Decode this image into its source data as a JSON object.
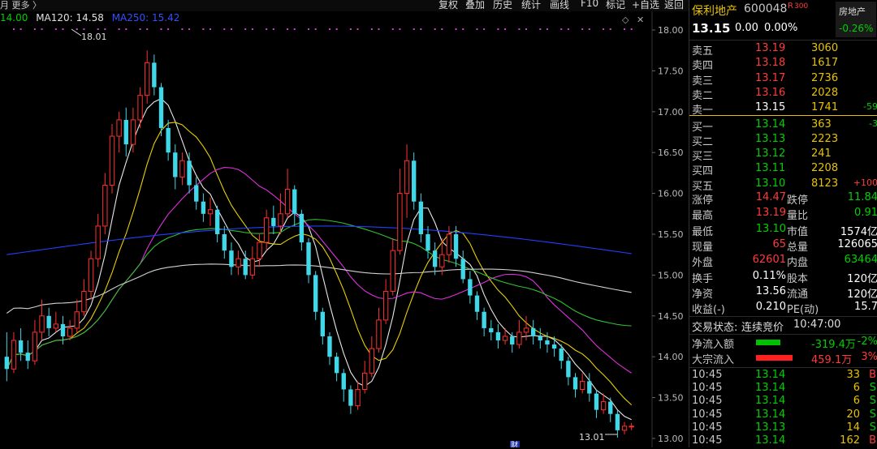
{
  "toolbar": {
    "left_text": "月 更多 〉",
    "buttons": [
      "复权",
      "叠加",
      "历史",
      "统计",
      "画线",
      "F10",
      "标记",
      "+自选",
      "返回"
    ]
  },
  "legend": [
    {
      "label": "14.00",
      "color": "#00d000"
    },
    {
      "label": "MA120: 14.58",
      "color": "#e0e0e0"
    },
    {
      "label": "MA250: 15.42",
      "color": "#3050ff"
    }
  ],
  "annotations": {
    "high": "18.01",
    "low": "13.01",
    "marker": "财"
  },
  "stock": {
    "name": "保利地产",
    "code": "600048",
    "badge": "R",
    "badge_num": "300",
    "sector": "房地产",
    "sector_change": "-0.26%",
    "price": "13.15",
    "change": "0.00",
    "change_pct": "0.00%"
  },
  "order_book": {
    "sell": [
      {
        "label": "卖五",
        "price": "13.19",
        "vol": "3060",
        "delta": ""
      },
      {
        "label": "卖四",
        "price": "13.18",
        "vol": "1617",
        "delta": ""
      },
      {
        "label": "卖三",
        "price": "13.17",
        "vol": "2736",
        "delta": ""
      },
      {
        "label": "卖二",
        "price": "13.16",
        "vol": "2028",
        "delta": ""
      },
      {
        "label": "卖一",
        "price": "13.15",
        "vol": "1741",
        "delta": "-59"
      }
    ],
    "buy": [
      {
        "label": "买一",
        "price": "13.14",
        "vol": "363",
        "delta": "-3"
      },
      {
        "label": "买二",
        "price": "13.13",
        "vol": "2223",
        "delta": ""
      },
      {
        "label": "买三",
        "price": "13.12",
        "vol": "241",
        "delta": ""
      },
      {
        "label": "买四",
        "price": "13.11",
        "vol": "2208",
        "delta": ""
      },
      {
        "label": "买五",
        "price": "13.10",
        "vol": "8123",
        "delta": "+100"
      }
    ]
  },
  "stats": [
    {
      "l1": "涨停",
      "v1": "14.47",
      "c1": "red",
      "l2": "跌停",
      "v2": "11.84",
      "c2": "green"
    },
    {
      "l1": "最高",
      "v1": "13.19",
      "c1": "red",
      "l2": "量比",
      "v2": "0.91",
      "c2": "green"
    },
    {
      "l1": "最低",
      "v1": "13.10",
      "c1": "green",
      "l2": "市值",
      "v2": "1574亿",
      "c2": "white"
    },
    {
      "l1": "现量",
      "v1": "65",
      "c1": "red",
      "l2": "总量",
      "v2": "126065",
      "c2": "white"
    },
    {
      "l1": "外盘",
      "v1": "62601",
      "c1": "red",
      "l2": "内盘",
      "v2": "63464",
      "c2": "green"
    },
    {
      "l1": "换手",
      "v1": "0.11%",
      "c1": "white",
      "l2": "股本",
      "v2": "120亿",
      "c2": "white"
    },
    {
      "l1": "净资",
      "v1": "13.56",
      "c1": "white",
      "l2": "流通",
      "v2": "120亿",
      "c2": "white"
    },
    {
      "l1": "收益(-)",
      "v1": "0.210",
      "c1": "white",
      "l2": "PE(动)",
      "v2": "15.7",
      "c2": "white"
    }
  ],
  "trade_status": {
    "label": "交易状态:",
    "state": "连续竞价",
    "time": "10:47:00"
  },
  "flows": [
    {
      "label": "净流入额",
      "value": "-319.4万",
      "pct": "-2%",
      "bar_color": "#00c000",
      "color": "green"
    },
    {
      "label": "大宗流入",
      "value": "459.1万",
      "pct": "3%",
      "bar_color": "#ff2020",
      "color": "red"
    }
  ],
  "ticks": [
    {
      "time": "10:45",
      "price": "13.14",
      "vol": "33",
      "side": "B",
      "side_color": "red"
    },
    {
      "time": "10:45",
      "price": "13.14",
      "vol": "6",
      "side": "S",
      "side_color": "green"
    },
    {
      "time": "10:45",
      "price": "13.14",
      "vol": "6",
      "side": "S",
      "side_color": "green"
    },
    {
      "time": "10:45",
      "price": "13.14",
      "vol": "20",
      "side": "S",
      "side_color": "green"
    },
    {
      "time": "10:45",
      "price": "13.13",
      "vol": "14",
      "side": "S",
      "side_color": "green"
    },
    {
      "time": "10:45",
      "price": "13.14",
      "vol": "162",
      "side": "B",
      "side_color": "red"
    }
  ],
  "chart_data": {
    "type": "candlestick",
    "ylim": [
      12.95,
      18.05
    ],
    "y_ticks": [
      "18.00",
      "17.50",
      "17.00",
      "16.50",
      "16.00",
      "15.50",
      "15.00",
      "14.50",
      "14.00",
      "13.50",
      "13.00"
    ],
    "candles": [
      [
        14.0,
        13.85,
        14.3,
        13.7
      ],
      [
        13.85,
        14.2,
        14.3,
        13.8
      ],
      [
        14.2,
        14.05,
        14.35,
        13.95
      ],
      [
        14.05,
        13.95,
        14.2,
        13.85
      ],
      [
        13.95,
        14.3,
        14.45,
        13.9
      ],
      [
        14.3,
        14.5,
        14.7,
        14.2
      ],
      [
        14.5,
        14.35,
        14.6,
        14.25
      ],
      [
        14.35,
        14.4,
        14.55,
        14.3
      ],
      [
        14.4,
        14.25,
        14.5,
        14.15
      ],
      [
        14.25,
        14.35,
        14.45,
        14.2
      ],
      [
        14.35,
        14.55,
        14.7,
        14.3
      ],
      [
        14.55,
        14.8,
        14.95,
        14.5
      ],
      [
        14.8,
        15.2,
        15.3,
        14.7
      ],
      [
        15.2,
        15.6,
        15.75,
        15.1
      ],
      [
        15.6,
        16.1,
        16.25,
        15.5
      ],
      [
        16.1,
        16.7,
        16.85,
        16.0
      ],
      [
        16.7,
        16.9,
        17.0,
        16.5
      ],
      [
        16.9,
        16.6,
        17.05,
        16.45
      ],
      [
        16.6,
        16.9,
        17.05,
        16.5
      ],
      [
        16.9,
        17.2,
        17.3,
        16.8
      ],
      [
        17.2,
        17.6,
        17.75,
        17.1
      ],
      [
        17.6,
        17.3,
        17.7,
        17.2
      ],
      [
        17.3,
        16.8,
        17.35,
        16.7
      ],
      [
        16.8,
        16.5,
        16.9,
        16.4
      ],
      [
        16.5,
        16.2,
        16.6,
        16.05
      ],
      [
        16.2,
        16.4,
        16.5,
        16.1
      ],
      [
        16.4,
        16.1,
        16.5,
        16.0
      ],
      [
        16.1,
        15.9,
        16.2,
        15.8
      ],
      [
        15.9,
        15.75,
        16.0,
        15.65
      ],
      [
        15.75,
        15.8,
        15.95,
        15.6
      ],
      [
        15.8,
        15.5,
        15.85,
        15.4
      ],
      [
        15.5,
        15.3,
        15.6,
        15.2
      ],
      [
        15.3,
        15.1,
        15.4,
        15.0
      ],
      [
        15.1,
        15.2,
        15.3,
        15.0
      ],
      [
        15.2,
        15.0,
        15.3,
        14.95
      ],
      [
        15.0,
        15.2,
        15.35,
        14.95
      ],
      [
        15.2,
        15.4,
        15.5,
        15.1
      ],
      [
        15.4,
        15.7,
        15.8,
        15.3
      ],
      [
        15.7,
        15.6,
        15.85,
        15.5
      ],
      [
        15.6,
        15.75,
        16.0,
        15.5
      ],
      [
        15.75,
        16.05,
        16.3,
        15.7
      ],
      [
        16.05,
        15.75,
        16.1,
        15.6
      ],
      [
        15.75,
        15.4,
        15.8,
        15.3
      ],
      [
        15.4,
        15.0,
        15.45,
        14.9
      ],
      [
        15.0,
        14.55,
        15.05,
        14.45
      ],
      [
        14.55,
        14.25,
        14.6,
        14.15
      ],
      [
        14.25,
        14.0,
        14.3,
        13.9
      ],
      [
        14.0,
        13.8,
        14.05,
        13.7
      ],
      [
        13.8,
        13.6,
        13.85,
        13.45
      ],
      [
        13.6,
        13.4,
        13.65,
        13.3
      ],
      [
        13.4,
        13.6,
        13.7,
        13.35
      ],
      [
        13.6,
        13.8,
        13.95,
        13.55
      ],
      [
        13.8,
        14.1,
        14.25,
        13.75
      ],
      [
        14.1,
        14.45,
        14.6,
        14.05
      ],
      [
        14.45,
        14.8,
        14.95,
        14.4
      ],
      [
        14.8,
        15.3,
        15.45,
        14.75
      ],
      [
        15.3,
        16.0,
        16.3,
        15.25
      ],
      [
        16.0,
        16.4,
        16.6,
        15.7
      ],
      [
        16.4,
        15.9,
        16.5,
        15.8
      ],
      [
        15.9,
        15.5,
        16.0,
        15.4
      ],
      [
        15.5,
        15.3,
        15.6,
        15.2
      ],
      [
        15.3,
        15.1,
        15.4,
        15.0
      ],
      [
        15.1,
        15.25,
        15.45,
        15.0
      ],
      [
        15.25,
        15.5,
        15.6,
        15.15
      ],
      [
        15.5,
        15.2,
        15.6,
        15.1
      ],
      [
        15.2,
        14.95,
        15.3,
        14.9
      ],
      [
        14.95,
        14.75,
        15.05,
        14.65
      ],
      [
        14.75,
        14.55,
        14.8,
        14.45
      ],
      [
        14.55,
        14.35,
        14.6,
        14.25
      ],
      [
        14.35,
        14.3,
        14.45,
        14.2
      ],
      [
        14.3,
        14.2,
        14.4,
        14.1
      ],
      [
        14.2,
        14.25,
        14.35,
        14.15
      ],
      [
        14.25,
        14.15,
        14.3,
        14.05
      ],
      [
        14.15,
        14.3,
        14.45,
        14.1
      ],
      [
        14.3,
        14.35,
        14.5,
        14.2
      ],
      [
        14.35,
        14.25,
        14.45,
        14.15
      ],
      [
        14.25,
        14.2,
        14.35,
        14.1
      ],
      [
        14.2,
        14.15,
        14.3,
        14.05
      ],
      [
        14.15,
        14.1,
        14.25,
        14.0
      ],
      [
        14.1,
        13.95,
        14.15,
        13.85
      ],
      [
        13.95,
        13.75,
        14.0,
        13.65
      ],
      [
        13.75,
        13.6,
        13.8,
        13.5
      ],
      [
        13.6,
        13.7,
        13.8,
        13.55
      ],
      [
        13.7,
        13.55,
        13.8,
        13.45
      ],
      [
        13.55,
        13.35,
        13.6,
        13.25
      ],
      [
        13.35,
        13.45,
        13.55,
        13.3
      ],
      [
        13.45,
        13.3,
        13.5,
        13.2
      ],
      [
        13.3,
        13.1,
        13.35,
        13.01
      ],
      [
        13.1,
        13.15,
        13.2,
        13.05
      ],
      [
        13.15,
        13.15,
        13.19,
        13.1
      ]
    ]
  }
}
